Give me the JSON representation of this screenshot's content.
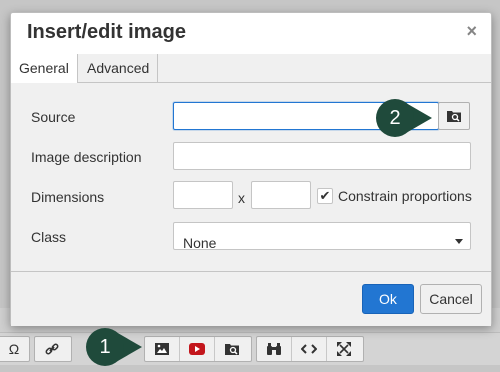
{
  "dialog": {
    "title": "Insert/edit image",
    "close_glyph": "×",
    "tabs": [
      {
        "label": "General",
        "active": true
      },
      {
        "label": "Advanced",
        "active": false
      }
    ],
    "fields": {
      "source_label": "Source",
      "source_value": "",
      "description_label": "Image description",
      "description_value": "",
      "dimensions_label": "Dimensions",
      "width_value": "",
      "height_value": "",
      "times_glyph": "x",
      "constrain_label": "Constrain proportions",
      "constrain_checked": true,
      "class_label": "Class",
      "class_value": "None"
    },
    "buttons": {
      "ok": "Ok",
      "cancel": "Cancel"
    }
  },
  "callouts": {
    "one": "1",
    "two": "2"
  },
  "toolbar": {
    "omega_glyph": "Ω",
    "icons": [
      "omega-icon",
      "link-icon",
      "image-icon",
      "youtube-icon",
      "browse-icon",
      "binoculars-icon",
      "code-icon",
      "fullscreen-icon"
    ]
  },
  "colors": {
    "primary": "#2276d2",
    "callout": "#1f4a3b",
    "focus_border": "#2276d2"
  }
}
